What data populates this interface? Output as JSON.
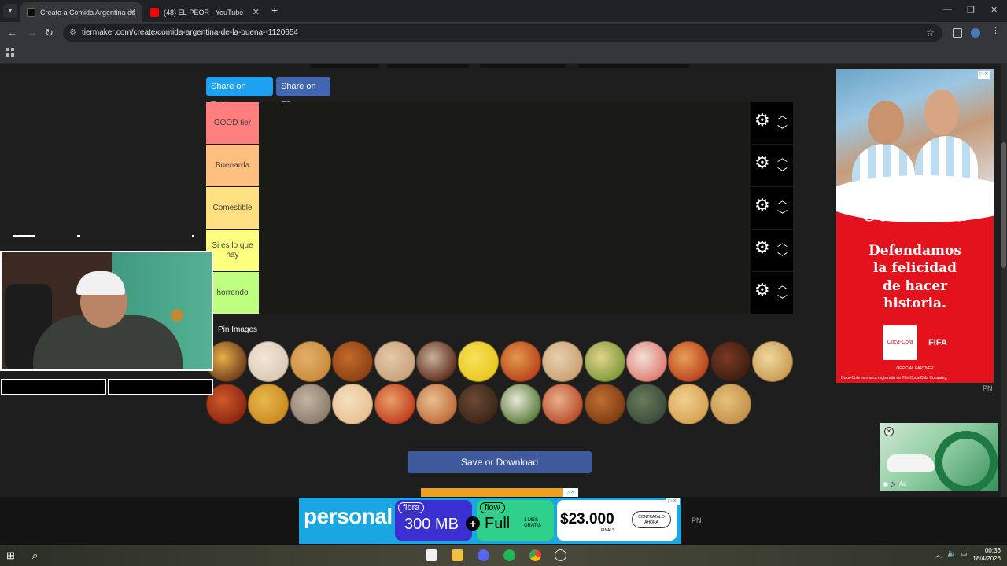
{
  "browser": {
    "tabs": [
      {
        "title": "Create a Comida Argentina de",
        "active": true,
        "favicon_color": "#111111"
      },
      {
        "title": "(48) EL-PEOR - YouTube",
        "active": false,
        "favicon_color": "#ff0000"
      }
    ],
    "url": "tiermaker.com/create/comida-argentina-de-la-buena--1120654"
  },
  "share": {
    "twitter_label": "Share on Twitter",
    "facebook_label": "Share on FB",
    "twitter_color": "#1da1f2",
    "facebook_color": "#4267b2"
  },
  "tiers": [
    {
      "label": "GOOD tier",
      "color": "#ff7f7f"
    },
    {
      "label": "Buenarda",
      "color": "#ffbf7f"
    },
    {
      "label": "Comestible",
      "color": "#ffdf7f"
    },
    {
      "label": "Si es lo que hay",
      "color": "#ffff7f"
    },
    {
      "label": "horrendo",
      "color": "#bfff7f"
    }
  ],
  "pin_images_label": "Pin Images",
  "food_items": [
    {
      "icon": "burger-icon",
      "c1": "#6b3a1c",
      "c2": "#e8b048"
    },
    {
      "icon": "sandwich-icon",
      "c1": "#d9c8b4",
      "c2": "#f3e6d8"
    },
    {
      "icon": "empanada-icon",
      "c1": "#c98a3a",
      "c2": "#e2b06a"
    },
    {
      "icon": "stew-icon",
      "c1": "#8a3f14",
      "c2": "#c46a2a"
    },
    {
      "icon": "spaghetti-icon",
      "c1": "#c9a07a",
      "c2": "#e4c9a8"
    },
    {
      "icon": "meatballs-icon",
      "c1": "#5a2a18",
      "c2": "#c9b09a"
    },
    {
      "icon": "pasta-icon",
      "c1": "#e8c620",
      "c2": "#f7e25a"
    },
    {
      "icon": "pizza-icon",
      "c1": "#b8411c",
      "c2": "#e29a4a"
    },
    {
      "icon": "canelones-icon",
      "c1": "#c9a070",
      "c2": "#e8d0b0"
    },
    {
      "icon": "tart-icon",
      "c1": "#7a9a3a",
      "c2": "#e4d28a"
    },
    {
      "icon": "sushi-icon",
      "c1": "#e07a70",
      "c2": "#f0e0d8"
    },
    {
      "icon": "lasagna-icon",
      "c1": "#b8401c",
      "c2": "#e8a05a"
    },
    {
      "icon": "asado-icon",
      "c1": "#3a1c10",
      "c2": "#7a3a24"
    },
    {
      "icon": "bread-icon",
      "c1": "#c99a50",
      "c2": "#f0d8a0"
    },
    {
      "icon": "locro-icon",
      "c1": "#8a2410",
      "c2": "#d05a2a"
    },
    {
      "icon": "nuggets-icon",
      "c1": "#c98a20",
      "c2": "#e8b84a"
    },
    {
      "icon": "milanesa-icon",
      "c1": "#8a7a6a",
      "c2": "#c4b4a4"
    },
    {
      "icon": "quesadilla-icon",
      "c1": "#e8c090",
      "c2": "#f4e0c0"
    },
    {
      "icon": "pepperoni-pizza-icon",
      "c1": "#c03a1a",
      "c2": "#e8a06a"
    },
    {
      "icon": "hotdog-icon",
      "c1": "#c06a3a",
      "c2": "#e8c090"
    },
    {
      "icon": "chocolate-cake-icon",
      "c1": "#3a2418",
      "c2": "#6a4a34"
    },
    {
      "icon": "salad-icon",
      "c1": "#5a7a3a",
      "c2": "#e8e8d8"
    },
    {
      "icon": "ravioli-icon",
      "c1": "#b84a2a",
      "c2": "#e8b08a"
    },
    {
      "icon": "roast-chicken-icon",
      "c1": "#7a3a14",
      "c2": "#c07030"
    },
    {
      "icon": "vegetables-icon",
      "c1": "#3a4a3a",
      "c2": "#6a7a5a"
    },
    {
      "icon": "pastry-icon",
      "c1": "#d8a050",
      "c2": "#f0d090"
    },
    {
      "icon": "fries-icon",
      "c1": "#c0904a",
      "c2": "#e8c07a"
    }
  ],
  "save_label": "Save or Download",
  "side_ad": {
    "brand": "Coca-Cola",
    "slogan_lines": [
      "Defendamos",
      "la felicidad",
      "de hacer",
      "historia."
    ],
    "logo_left": "Coca-Cola",
    "logo_right": "FIFA",
    "partner": "OFFICIAL PARTNER",
    "disclaimer": "Coca-Cola es marca registrada de The Coca-Cola Company.",
    "pn": "PN"
  },
  "bottom_ad": {
    "brand": "personal",
    "fibra_tag": "fibra",
    "fibra_value": "300 MB",
    "flow_tag": "flow",
    "flow_value": "Full",
    "flow_sub": "1 MES GRATIS",
    "price": "$23.000",
    "price_sub": "FINAL*",
    "cta": "CONTRATALO AHORA",
    "pn": "PN"
  },
  "clock": {
    "time": "00:36",
    "date": "18/4/2026"
  }
}
